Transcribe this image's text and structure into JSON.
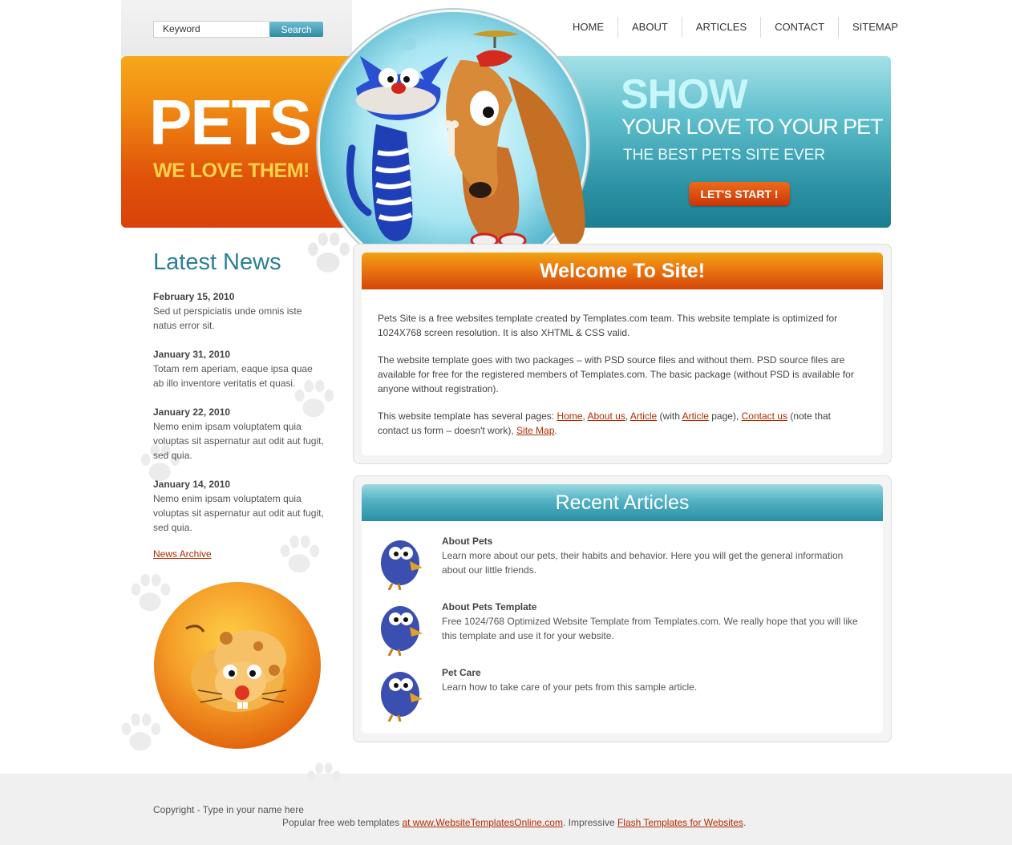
{
  "search": {
    "placeholder": "Keyword",
    "button_label": "Search"
  },
  "nav": {
    "items": [
      "HOME",
      "ABOUT",
      "ARTICLES",
      "CONTACT",
      "SITEMAP"
    ]
  },
  "brand": {
    "title": "PETS",
    "tagline": "WE LOVE THEM!"
  },
  "hero": {
    "show": "SHOW",
    "line1": "YOUR LOVE TO YOUR PET",
    "line2": "THE BEST PETS SITE EVER",
    "button_label": "LET'S START !"
  },
  "news": {
    "title": "Latest News",
    "items": [
      {
        "date": "February 15, 2010",
        "text": "Sed ut perspiciatis unde omnis iste natus error sit."
      },
      {
        "date": "January 31, 2010",
        "text": "Totam rem aperiam, eaque ipsa quae ab illo inventore veritatis et quasi."
      },
      {
        "date": "January 22, 2010",
        "text": "Nemo enim ipsam voluptatem quia voluptas sit aspernatur aut odit aut fugit, sed quia."
      },
      {
        "date": "January 14, 2010",
        "text": "Nemo enim ipsam voluptatem quia voluptas sit aspernatur aut odit aut fugit, sed quia."
      }
    ],
    "archive_label": "News Archive"
  },
  "welcome": {
    "title": "Welcome To Site!",
    "p1": "Pets Site is a free websites template created by Templates.com team. This website template is optimized for 1024X768 screen resolution. It is also XHTML & CSS valid.",
    "p2": "The website template goes with two packages – with PSD source files and without them. PSD source files are available for free for the registered members of Templates.com. The basic package (without PSD is available for anyone without registration).",
    "p3": {
      "t1": "This website template has several pages: ",
      "l_home": "Home",
      "s1": ", ",
      "l_about": "About us",
      "s2": ", ",
      "l_article": "Article",
      "t2": " (with ",
      "l_article2": "Article",
      "t3": " page), ",
      "l_contact": "Contact us",
      "t4": " (note that contact us form – doesn't work), ",
      "l_sitemap": "Site Map",
      "t5": "."
    }
  },
  "articles": {
    "title": "Recent Articles",
    "items": [
      {
        "title": "About Pets",
        "text": "Learn more about our pets, their habits and behavior. Here you will get the general information about our little friends."
      },
      {
        "title": "About Pets Template",
        "text": "Free 1024/768 Optimized Website Template from Templates.com. We really hope that you will like this template and use it for your website."
      },
      {
        "title": "Pet Care",
        "text": "Learn how to take care of your pets from this sample article."
      }
    ]
  },
  "footer": {
    "copyright": "Copyright - Type in your name here",
    "line_prefix": "Popular free web templates ",
    "link1": "at www.WebsiteTemplatesOnline.com",
    "line_middle": ". Impressive ",
    "link2": "Flash Templates for Websites",
    "line_suffix": "."
  },
  "colors": {
    "orange": "#e0530a",
    "teal": "#2e93a6",
    "link": "#b32a00"
  }
}
